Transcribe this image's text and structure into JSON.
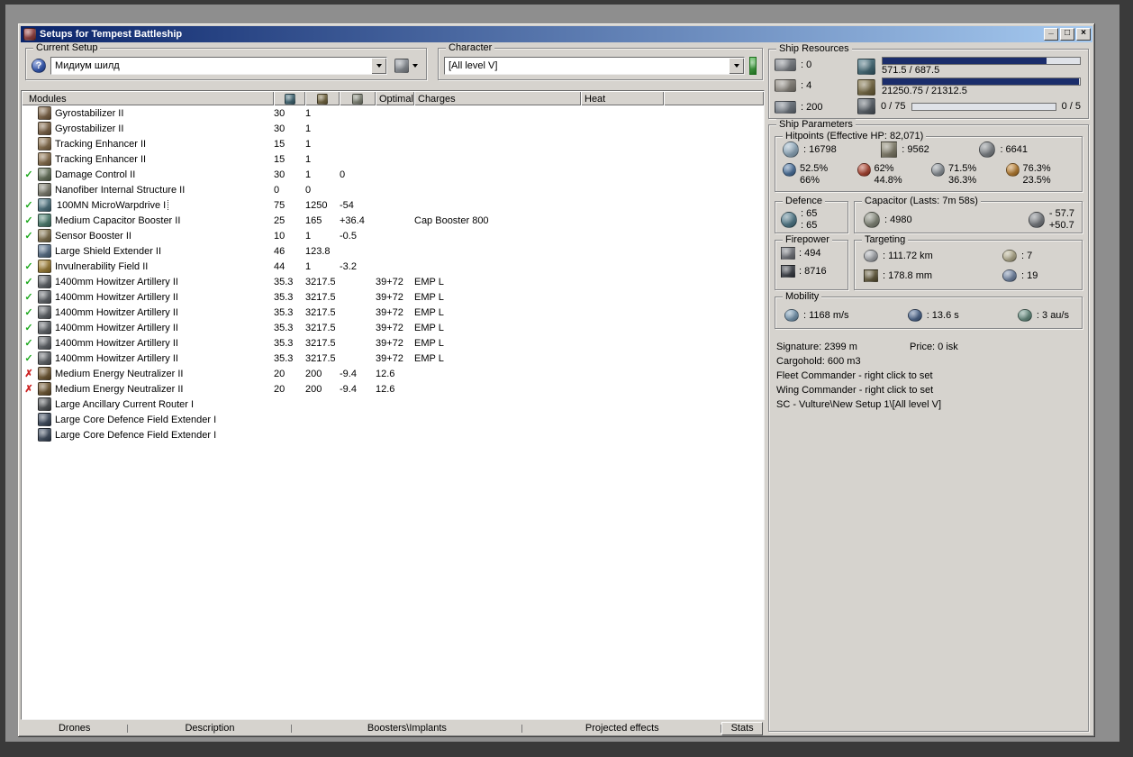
{
  "window": {
    "title": "Setups for Tempest Battleship",
    "buttons": {
      "minimize": "_",
      "maximize": "□",
      "close": "×"
    }
  },
  "setup": {
    "label": "Current Setup",
    "value": "Мидиум шилд",
    "help_glyph": "?"
  },
  "character": {
    "label": "Character",
    "value": "[All level V]"
  },
  "modules": {
    "header": {
      "title": "Modules",
      "optimal": "Optimal",
      "charges": "Charges",
      "heat": "Heat"
    },
    "rows": [
      {
        "state": "",
        "icon": "gyrostabilizer-icon",
        "tint": "#8a6a46",
        "name": "Gyrostabilizer II",
        "cpu": "30",
        "pg": "1"
      },
      {
        "state": "",
        "icon": "gyrostabilizer-icon",
        "tint": "#8a6a46",
        "name": "Gyrostabilizer II",
        "cpu": "30",
        "pg": "1"
      },
      {
        "state": "",
        "icon": "tracking-enhancer-icon",
        "tint": "#97784e",
        "name": "Tracking Enhancer II",
        "cpu": "15",
        "pg": "1"
      },
      {
        "state": "",
        "icon": "tracking-enhancer-icon",
        "tint": "#97784e",
        "name": "Tracking Enhancer II",
        "cpu": "15",
        "pg": "1"
      },
      {
        "state": "on",
        "icon": "damage-control-icon",
        "tint": "#6f7f62",
        "name": "Damage Control II",
        "cpu": "30",
        "pg": "1",
        "cap": "0"
      },
      {
        "state": "",
        "icon": "nanofiber-structure-icon",
        "tint": "#8a8a78",
        "name": "Nanofiber Internal Structure II",
        "cpu": "0",
        "pg": "0"
      },
      {
        "state": "on",
        "selected": true,
        "icon": "microwarpdrive-icon",
        "tint": "#4e7d8d",
        "name": "100MN MicroWarpdrive I",
        "cpu": "75",
        "pg": "1250",
        "cap": "-54"
      },
      {
        "state": "on",
        "icon": "capacitor-booster-icon",
        "tint": "#4e8d7a",
        "name": "Medium Capacitor Booster II",
        "cpu": "25",
        "pg": "165",
        "cap": "+36.4",
        "charges": "Cap Booster 800"
      },
      {
        "state": "on",
        "icon": "sensor-booster-icon",
        "tint": "#8d7a4e",
        "name": "Sensor Booster II",
        "cpu": "10",
        "pg": "1",
        "cap": "-0.5"
      },
      {
        "state": "",
        "icon": "shield-extender-icon",
        "tint": "#5d7a99",
        "name": "Large Shield Extender II",
        "cpu": "46",
        "pg": "123.8"
      },
      {
        "state": "on",
        "icon": "invulnerability-field-icon",
        "tint": "#b08a30",
        "name": "Invulnerability Field II",
        "cpu": "44",
        "pg": "1",
        "cap": "-3.2"
      },
      {
        "state": "on",
        "icon": "artillery-icon",
        "tint": "#676c72",
        "name": "1400mm Howitzer Artillery II",
        "cpu": "35.3",
        "pg": "3217.5",
        "optimal": "39+72",
        "charges": "EMP L"
      },
      {
        "state": "on",
        "icon": "artillery-icon",
        "tint": "#676c72",
        "name": "1400mm Howitzer Artillery II",
        "cpu": "35.3",
        "pg": "3217.5",
        "optimal": "39+72",
        "charges": "EMP L"
      },
      {
        "state": "on",
        "icon": "artillery-icon",
        "tint": "#676c72",
        "name": "1400mm Howitzer Artillery II",
        "cpu": "35.3",
        "pg": "3217.5",
        "optimal": "39+72",
        "charges": "EMP L"
      },
      {
        "state": "on",
        "icon": "artillery-icon",
        "tint": "#676c72",
        "name": "1400mm Howitzer Artillery II",
        "cpu": "35.3",
        "pg": "3217.5",
        "optimal": "39+72",
        "charges": "EMP L"
      },
      {
        "state": "on",
        "icon": "artillery-icon",
        "tint": "#676c72",
        "name": "1400mm Howitzer Artillery II",
        "cpu": "35.3",
        "pg": "3217.5",
        "optimal": "39+72",
        "charges": "EMP L"
      },
      {
        "state": "on",
        "icon": "artillery-icon",
        "tint": "#676c72",
        "name": "1400mm Howitzer Artillery II",
        "cpu": "35.3",
        "pg": "3217.5",
        "optimal": "39+72",
        "charges": "EMP L"
      },
      {
        "state": "off",
        "icon": "energy-neutralizer-icon",
        "tint": "#7a5c2e",
        "name": "Medium Energy Neutralizer II",
        "cpu": "20",
        "pg": "200",
        "cap": "-9.4",
        "optimal": "12.6"
      },
      {
        "state": "off",
        "icon": "energy-neutralizer-icon",
        "tint": "#7a5c2e",
        "name": "Medium Energy Neutralizer II",
        "cpu": "20",
        "pg": "200",
        "cap": "-9.4",
        "optimal": "12.6"
      },
      {
        "state": "",
        "icon": "ancillary-current-router-icon",
        "tint": "#54585c",
        "name": "Large Ancillary Current Router I"
      },
      {
        "state": "",
        "icon": "core-defence-field-extender-icon",
        "tint": "#3d4d64",
        "name": "Large Core Defence Field Extender I"
      },
      {
        "state": "",
        "icon": "core-defence-field-extender-icon",
        "tint": "#3d4d64",
        "name": "Large Core Defence Field Extender I"
      }
    ]
  },
  "resources": {
    "label": "Ship Resources",
    "slots": [
      {
        "icon": "turret-hardpoint-icon",
        "value": ": 0"
      },
      {
        "icon": "launcher-hardpoint-icon",
        "value": ": 4"
      },
      {
        "icon": "calibration-icon",
        "value": ": 200"
      }
    ],
    "cpu": {
      "text": "571.5 / 687.5",
      "fill_pct": 83
    },
    "powergrid": {
      "text": "21250.75 / 21312.5",
      "fill_pct": 99.7
    },
    "drones": {
      "text": "0 / 75",
      "fill_pct": 0,
      "extra": "0 / 5"
    }
  },
  "parameters": {
    "label": "Ship Parameters",
    "hitpoints": {
      "label": "Hitpoints (Effective HP: 82,071)",
      "pools": [
        {
          "icon": "shield-icon",
          "value": ": 16798"
        },
        {
          "icon": "armor-icon",
          "value": ": 9562"
        },
        {
          "icon": "structure-icon",
          "value": ": 6641"
        }
      ],
      "resists": [
        {
          "icon": "em-resist-icon",
          "top": "52.5%",
          "bottom": "66%"
        },
        {
          "icon": "thermal-resist-icon",
          "top": "62%",
          "bottom": "44.8%"
        },
        {
          "icon": "kinetic-resist-icon",
          "top": "71.5%",
          "bottom": "36.3%"
        },
        {
          "icon": "explosive-resist-icon",
          "top": "76.3%",
          "bottom": "23.5%"
        }
      ]
    },
    "defence": {
      "label": "Defence",
      "top": ": 65",
      "bottom": ": 65"
    },
    "capacitor": {
      "label": "Capacitor (Lasts: 7m 58s)",
      "value": ": 4980",
      "minus": "- 57.7",
      "plus": "+50.7"
    },
    "firepower": {
      "label": "Firepower",
      "dps": ": 494",
      "volley": ": 8716"
    },
    "targeting": {
      "label": "Targeting",
      "range": ": 111.72 km",
      "max_targets": ": 7",
      "scan_res": ": 178.8 mm",
      "sensor": ": 19"
    },
    "mobility": {
      "label": "Mobility",
      "speed": ": 1168 m/s",
      "align": ": 13.6 s",
      "warp": ": 3 au/s"
    },
    "info": {
      "signature": "Signature: 2399 m",
      "price": "Price: 0 isk",
      "cargohold": "Cargohold: 600 m3",
      "fleet": "Fleet Commander - right click to set",
      "wing": "Wing Commander - right click to set",
      "sc": "SC - Vulture\\New Setup 1\\[All level V]"
    }
  },
  "tabs": {
    "items": [
      "Drones",
      "Description",
      "Boosters\\Implants",
      "Projected effects"
    ],
    "active": "Stats"
  },
  "icons": {
    "active_glyph": "✓",
    "offline_glyph": "✗"
  },
  "colors": {
    "chrome": "#d6d3ce",
    "titlebar_left": "#0a246a",
    "titlebar_right": "#a6caf0",
    "resource_bar_fill": "#1b2d6b",
    "active_green": "#1faa1f",
    "offline_red": "#cc2222",
    "character_ready_green": "#35b335"
  },
  "icon_tints": {
    "app-icon": "#a43c3c",
    "help-icon": "#2a5ad0",
    "tools-icon": "#9aa0a8",
    "character-ready-indicator": "#35b335",
    "cpu-icon": "#3f6f7f",
    "powergrid-icon": "#7f6f3f",
    "capacitor-icon": "#8f9482",
    "turret-hardpoint-icon": "#8a8f96",
    "launcher-hardpoint-icon": "#9a948a",
    "calibration-icon": "#78828e",
    "drone-bay-icon": "#5a646e",
    "shield-icon": "#9fc0d8",
    "armor-icon": "#8f8a72",
    "structure-icon": "#888e94",
    "em-resist-icon": "#4a7ab0",
    "thermal-resist-icon": "#c04028",
    "kinetic-resist-icon": "#9aa2aa",
    "explosive-resist-icon": "#d08828",
    "shield-boost-icon": "#4f8296",
    "cap-recharge-icon": "#7f848a",
    "turret-dps-icon": "#7f828a",
    "volley-icon": "#3a3f48",
    "targeting-range-icon": "#b8bcc2",
    "max-targets-icon": "#c8c09a",
    "scan-resolution-icon": "#6a5f3a",
    "sensor-strength-icon": "#7a92b8",
    "max-velocity-icon": "#7fa8c8",
    "align-time-icon": "#4a6a9a",
    "warp-speed-icon": "#6a9a8a"
  }
}
